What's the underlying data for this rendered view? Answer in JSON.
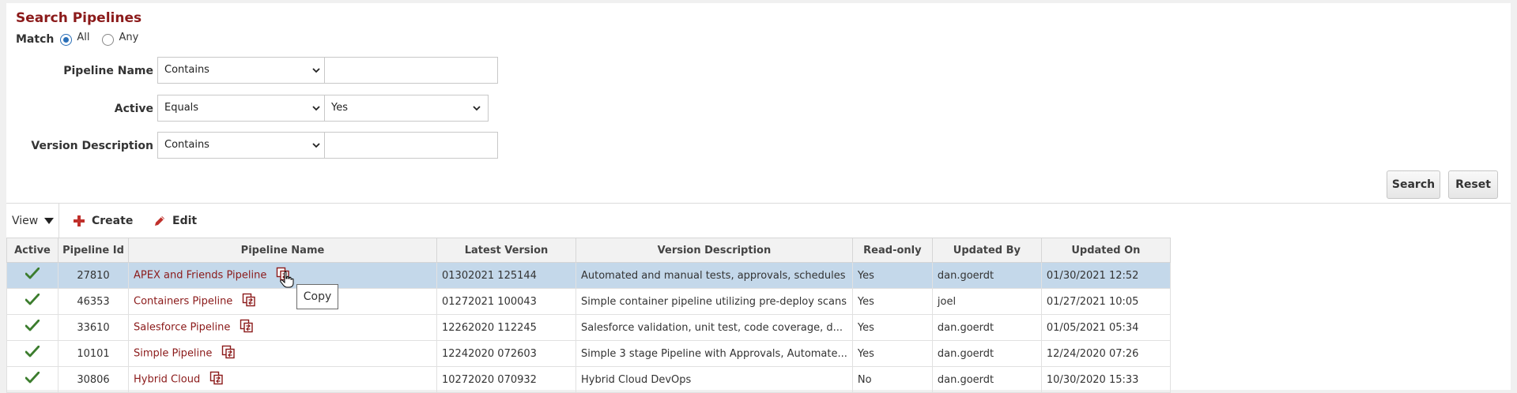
{
  "search": {
    "title": "Search Pipelines",
    "match_label": "Match",
    "match_options": [
      {
        "label": "All",
        "checked": true
      },
      {
        "label": "Any",
        "checked": false
      }
    ],
    "filters": [
      {
        "label": "Pipeline Name",
        "operator": "Contains",
        "value": ""
      },
      {
        "label": "Active",
        "operator": "Equals",
        "value": "Yes"
      },
      {
        "label": "Version Description",
        "operator": "Contains",
        "value": ""
      }
    ],
    "search_label": "Search",
    "reset_label": "Reset"
  },
  "toolbar": {
    "view_label": "View",
    "create_label": "Create",
    "edit_label": "Edit"
  },
  "table": {
    "columns": [
      "Active",
      "Pipeline Id",
      "Pipeline Name",
      "Latest Version",
      "Version Description",
      "Read-only",
      "Updated By",
      "Updated On"
    ],
    "rows": [
      {
        "active": "✓",
        "id": "27810",
        "name": "APEX and Friends Pipeline",
        "version": "01302021 125144",
        "version_green": true,
        "description": "Automated and manual tests, approvals, schedules",
        "readonly": "Yes",
        "updated_by": "dan.goerdt",
        "updated_on": "01/30/2021 12:52",
        "selected": true
      },
      {
        "active": "✓",
        "id": "46353",
        "name": "Containers Pipeline",
        "version": "01272021 100043",
        "version_green": true,
        "description": "Simple container pipeline utilizing pre-deploy scans",
        "readonly": "Yes",
        "updated_by": "joel",
        "updated_on": "01/27/2021 10:05",
        "selected": false
      },
      {
        "active": "✓",
        "id": "33610",
        "name": "Salesforce Pipeline",
        "version": "12262020 112245",
        "version_green": true,
        "description": "Salesforce validation, unit test, code coverage, d...",
        "readonly": "Yes",
        "updated_by": "dan.goerdt",
        "updated_on": "01/05/2021 05:34",
        "selected": false
      },
      {
        "active": "✓",
        "id": "10101",
        "name": "Simple Pipeline",
        "version": "12242020 072603",
        "version_green": true,
        "description": "Simple 3 stage Pipeline with Approvals, Automate...",
        "readonly": "Yes",
        "updated_by": "dan.goerdt",
        "updated_on": "12/24/2020 07:26",
        "selected": false
      },
      {
        "active": "✓",
        "id": "30806",
        "name": "Hybrid Cloud",
        "version": "10272020 070932",
        "version_green": false,
        "description": "Hybrid Cloud DevOps",
        "readonly": "No",
        "updated_by": "dan.goerdt",
        "updated_on": "10/30/2020 15:33",
        "selected": false
      }
    ]
  },
  "tooltip": {
    "text": "Copy"
  },
  "colors": {
    "title": "#8b1a1a",
    "link": "#8b1a1a",
    "version_green": "#2d7d1a",
    "check_green": "#3c7d2e",
    "selected_row": "#c4d8ea",
    "create_plus": "#c0302b"
  },
  "icons": {
    "active": "check-icon",
    "copy": "copy-icon",
    "create": "plus-icon",
    "edit": "pencil-icon",
    "view": "caret-down-icon"
  }
}
